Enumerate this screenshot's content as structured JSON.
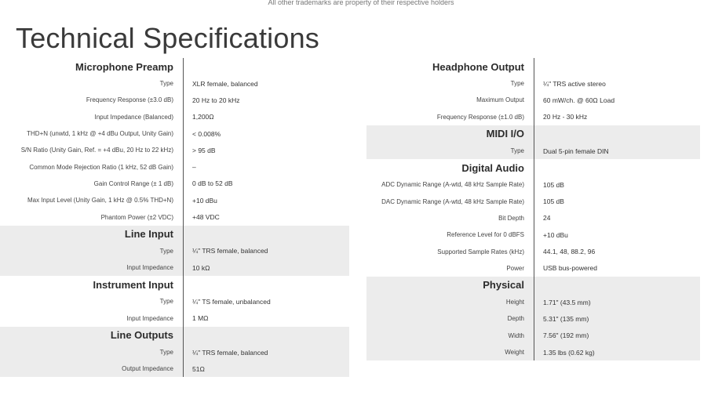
{
  "trademark": "All other trademarks are property of their respective holders",
  "page_title": "Technical Specifications",
  "left_sections": [
    {
      "title": "Microphone Preamp",
      "shaded": false,
      "rows": [
        {
          "label": "Type",
          "value": "XLR female, balanced"
        },
        {
          "label": "Frequency Response (±3.0 dB)",
          "value": "20 Hz to 20 kHz"
        },
        {
          "label": "Input Impedance (Balanced)",
          "value": "1,200Ω"
        },
        {
          "label": "THD+N (unwtd, 1 kHz @ +4 dBu Output, Unity Gain)",
          "value": "< 0.008%"
        },
        {
          "label": "S/N Ratio (Unity Gain, Ref. = +4 dBu, 20 Hz to 22 kHz)",
          "value": "> 95 dB"
        },
        {
          "label": "Common Mode Rejection Ratio (1 kHz, 52 dB Gain)",
          "value": "–"
        },
        {
          "label": "Gain Control Range (± 1 dB)",
          "value": "0 dB to 52 dB"
        },
        {
          "label": "Max Input Level (Unity Gain, 1 kHz @ 0.5% THD+N)",
          "value": "+10 dBu"
        },
        {
          "label": "Phantom Power (±2 VDC)",
          "value": "+48 VDC"
        }
      ]
    },
    {
      "title": "Line Input",
      "shaded": true,
      "rows": [
        {
          "label": "Type",
          "value": "¼\" TRS female, balanced"
        },
        {
          "label": "Input Impedance",
          "value": "10 kΩ"
        }
      ]
    },
    {
      "title": "Instrument Input",
      "shaded": false,
      "rows": [
        {
          "label": "Type",
          "value": "¼\" TS female, unbalanced"
        },
        {
          "label": "Input Impedance",
          "value": "1 MΩ"
        }
      ]
    },
    {
      "title": "Line Outputs",
      "shaded": true,
      "rows": [
        {
          "label": "Type",
          "value": "¼\" TRS female, balanced"
        },
        {
          "label": "Output Impedance",
          "value": "51Ω"
        }
      ]
    }
  ],
  "right_sections": [
    {
      "title": "Headphone Output",
      "shaded": false,
      "rows": [
        {
          "label": "Type",
          "value": "¼\" TRS active stereo"
        },
        {
          "label": "Maximum Output",
          "value": "60 mW/ch. @ 60Ω Load"
        },
        {
          "label": "Frequency Response (±1.0 dB)",
          "value": "20 Hz - 30 kHz"
        }
      ]
    },
    {
      "title": "MIDI I/O",
      "shaded": true,
      "rows": [
        {
          "label": "Type",
          "value": "Dual 5-pin female DIN"
        }
      ]
    },
    {
      "title": "Digital Audio",
      "shaded": false,
      "rows": [
        {
          "label": "ADC Dynamic Range (A-wtd, 48 kHz Sample Rate)",
          "value": "105 dB"
        },
        {
          "label": "DAC Dynamic Range (A-wtd, 48 kHz Sample Rate)",
          "value": "105 dB"
        },
        {
          "label": "Bit Depth",
          "value": "24"
        },
        {
          "label": "Reference Level for 0 dBFS",
          "value": "+10 dBu"
        },
        {
          "label": "Supported Sample Rates (kHz)",
          "value": "44.1, 48, 88.2, 96"
        },
        {
          "label": "Power",
          "value": "USB bus-powered"
        }
      ]
    },
    {
      "title": "Physical",
      "shaded": true,
      "rows": [
        {
          "label": "Height",
          "value": "1.71\" (43.5 mm)"
        },
        {
          "label": "Depth",
          "value": "5.31\" (135 mm)"
        },
        {
          "label": "Width",
          "value": "7.56\" (192 mm)"
        },
        {
          "label": "Weight",
          "value": "1.35 lbs (0.62 kg)"
        }
      ]
    }
  ]
}
